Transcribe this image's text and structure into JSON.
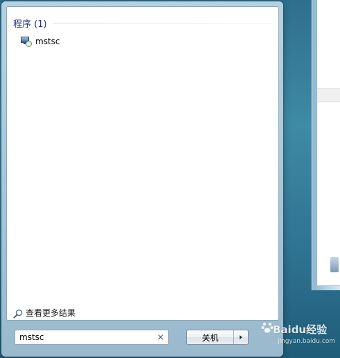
{
  "start_menu": {
    "section_title": "程序 (1)",
    "results": [
      {
        "label": "mstsc",
        "icon": "remote-desktop-icon"
      }
    ],
    "see_more": {
      "label": "查看更多结果",
      "icon": "search-icon"
    },
    "search": {
      "value": "mstsc",
      "clear_icon": "close-icon",
      "clear_symbol": "×"
    },
    "shutdown": {
      "label": "关机",
      "arrow_icon": "chevron-right-icon"
    }
  },
  "watermark": {
    "brand": "Baidu经验",
    "url": "jingyan.baidu.com"
  },
  "colors": {
    "section_title": "#1e3287",
    "desktop": "#2f7392",
    "start_frame": "#a8c3d8"
  }
}
